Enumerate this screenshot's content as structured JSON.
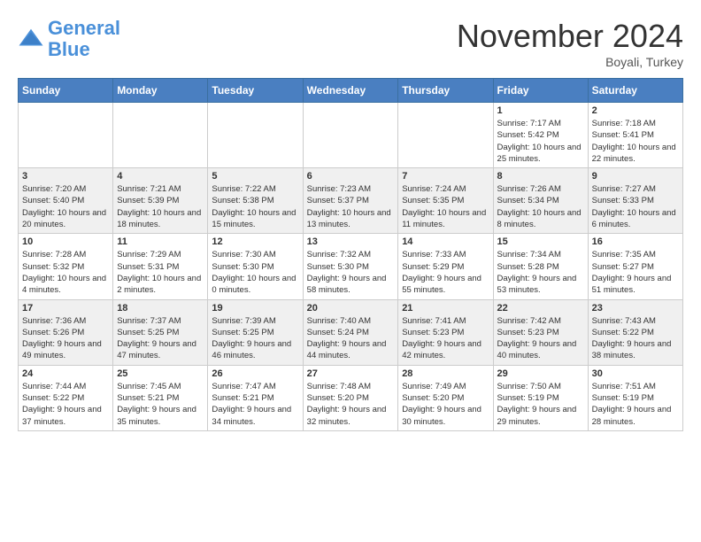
{
  "header": {
    "logo_line1": "General",
    "logo_line2": "Blue",
    "month_title": "November 2024",
    "location": "Boyali, Turkey"
  },
  "days_of_week": [
    "Sunday",
    "Monday",
    "Tuesday",
    "Wednesday",
    "Thursday",
    "Friday",
    "Saturday"
  ],
  "weeks": [
    {
      "row_bg": "light",
      "days": [
        {
          "date": "",
          "content": ""
        },
        {
          "date": "",
          "content": ""
        },
        {
          "date": "",
          "content": ""
        },
        {
          "date": "",
          "content": ""
        },
        {
          "date": "",
          "content": ""
        },
        {
          "date": "1",
          "content": "Sunrise: 7:17 AM\nSunset: 5:42 PM\nDaylight: 10 hours and 25 minutes."
        },
        {
          "date": "2",
          "content": "Sunrise: 7:18 AM\nSunset: 5:41 PM\nDaylight: 10 hours and 22 minutes."
        }
      ]
    },
    {
      "row_bg": "dark",
      "days": [
        {
          "date": "3",
          "content": "Sunrise: 7:20 AM\nSunset: 5:40 PM\nDaylight: 10 hours and 20 minutes."
        },
        {
          "date": "4",
          "content": "Sunrise: 7:21 AM\nSunset: 5:39 PM\nDaylight: 10 hours and 18 minutes."
        },
        {
          "date": "5",
          "content": "Sunrise: 7:22 AM\nSunset: 5:38 PM\nDaylight: 10 hours and 15 minutes."
        },
        {
          "date": "6",
          "content": "Sunrise: 7:23 AM\nSunset: 5:37 PM\nDaylight: 10 hours and 13 minutes."
        },
        {
          "date": "7",
          "content": "Sunrise: 7:24 AM\nSunset: 5:35 PM\nDaylight: 10 hours and 11 minutes."
        },
        {
          "date": "8",
          "content": "Sunrise: 7:26 AM\nSunset: 5:34 PM\nDaylight: 10 hours and 8 minutes."
        },
        {
          "date": "9",
          "content": "Sunrise: 7:27 AM\nSunset: 5:33 PM\nDaylight: 10 hours and 6 minutes."
        }
      ]
    },
    {
      "row_bg": "light",
      "days": [
        {
          "date": "10",
          "content": "Sunrise: 7:28 AM\nSunset: 5:32 PM\nDaylight: 10 hours and 4 minutes."
        },
        {
          "date": "11",
          "content": "Sunrise: 7:29 AM\nSunset: 5:31 PM\nDaylight: 10 hours and 2 minutes."
        },
        {
          "date": "12",
          "content": "Sunrise: 7:30 AM\nSunset: 5:30 PM\nDaylight: 10 hours and 0 minutes."
        },
        {
          "date": "13",
          "content": "Sunrise: 7:32 AM\nSunset: 5:30 PM\nDaylight: 9 hours and 58 minutes."
        },
        {
          "date": "14",
          "content": "Sunrise: 7:33 AM\nSunset: 5:29 PM\nDaylight: 9 hours and 55 minutes."
        },
        {
          "date": "15",
          "content": "Sunrise: 7:34 AM\nSunset: 5:28 PM\nDaylight: 9 hours and 53 minutes."
        },
        {
          "date": "16",
          "content": "Sunrise: 7:35 AM\nSunset: 5:27 PM\nDaylight: 9 hours and 51 minutes."
        }
      ]
    },
    {
      "row_bg": "dark",
      "days": [
        {
          "date": "17",
          "content": "Sunrise: 7:36 AM\nSunset: 5:26 PM\nDaylight: 9 hours and 49 minutes."
        },
        {
          "date": "18",
          "content": "Sunrise: 7:37 AM\nSunset: 5:25 PM\nDaylight: 9 hours and 47 minutes."
        },
        {
          "date": "19",
          "content": "Sunrise: 7:39 AM\nSunset: 5:25 PM\nDaylight: 9 hours and 46 minutes."
        },
        {
          "date": "20",
          "content": "Sunrise: 7:40 AM\nSunset: 5:24 PM\nDaylight: 9 hours and 44 minutes."
        },
        {
          "date": "21",
          "content": "Sunrise: 7:41 AM\nSunset: 5:23 PM\nDaylight: 9 hours and 42 minutes."
        },
        {
          "date": "22",
          "content": "Sunrise: 7:42 AM\nSunset: 5:23 PM\nDaylight: 9 hours and 40 minutes."
        },
        {
          "date": "23",
          "content": "Sunrise: 7:43 AM\nSunset: 5:22 PM\nDaylight: 9 hours and 38 minutes."
        }
      ]
    },
    {
      "row_bg": "light",
      "days": [
        {
          "date": "24",
          "content": "Sunrise: 7:44 AM\nSunset: 5:22 PM\nDaylight: 9 hours and 37 minutes."
        },
        {
          "date": "25",
          "content": "Sunrise: 7:45 AM\nSunset: 5:21 PM\nDaylight: 9 hours and 35 minutes."
        },
        {
          "date": "26",
          "content": "Sunrise: 7:47 AM\nSunset: 5:21 PM\nDaylight: 9 hours and 34 minutes."
        },
        {
          "date": "27",
          "content": "Sunrise: 7:48 AM\nSunset: 5:20 PM\nDaylight: 9 hours and 32 minutes."
        },
        {
          "date": "28",
          "content": "Sunrise: 7:49 AM\nSunset: 5:20 PM\nDaylight: 9 hours and 30 minutes."
        },
        {
          "date": "29",
          "content": "Sunrise: 7:50 AM\nSunset: 5:19 PM\nDaylight: 9 hours and 29 minutes."
        },
        {
          "date": "30",
          "content": "Sunrise: 7:51 AM\nSunset: 5:19 PM\nDaylight: 9 hours and 28 minutes."
        }
      ]
    }
  ]
}
